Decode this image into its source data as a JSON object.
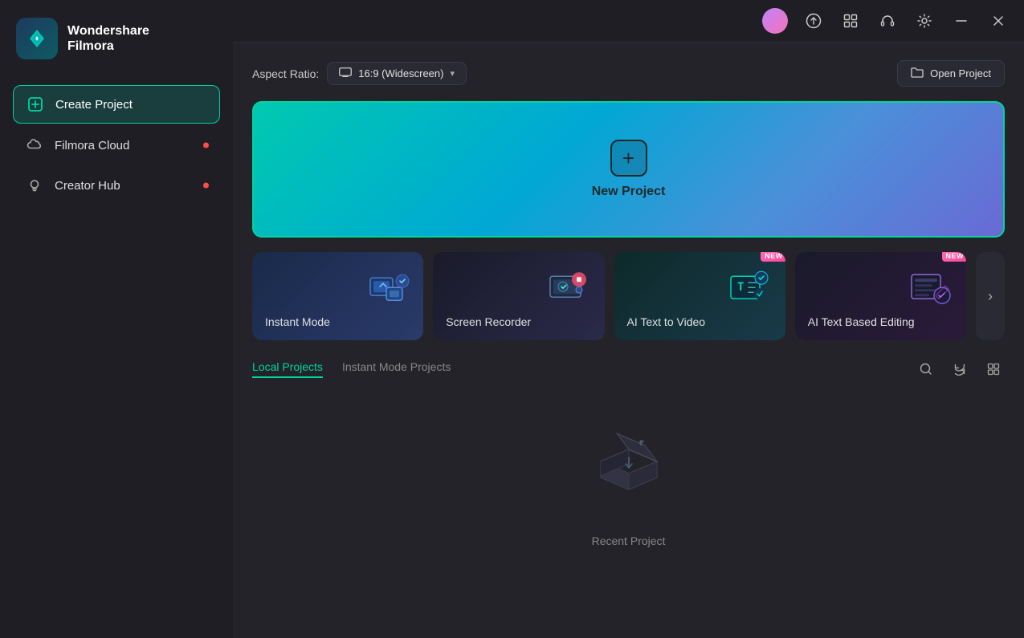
{
  "app": {
    "name": "Wondershare",
    "product": "Filmora"
  },
  "topbar": {
    "icons": [
      "grid-icon",
      "headset-icon",
      "badge-icon",
      "minimize-icon",
      "close-icon"
    ]
  },
  "sidebar": {
    "items": [
      {
        "id": "create-project",
        "label": "Create Project",
        "icon": "plus-square-icon",
        "active": true,
        "badge": false
      },
      {
        "id": "filmora-cloud",
        "label": "Filmora Cloud",
        "icon": "cloud-icon",
        "active": false,
        "badge": true
      },
      {
        "id": "creator-hub",
        "label": "Creator Hub",
        "icon": "lightbulb-icon",
        "active": false,
        "badge": true
      }
    ]
  },
  "aspect_ratio": {
    "label": "Aspect Ratio:",
    "value": "16:9 (Widescreen)",
    "icon": "monitor-icon"
  },
  "open_project": {
    "label": "Open Project",
    "icon": "folder-icon"
  },
  "new_project": {
    "label": "New Project"
  },
  "feature_cards": [
    {
      "id": "instant-mode",
      "label": "Instant Mode",
      "badge": null
    },
    {
      "id": "screen-recorder",
      "label": "Screen Recorder",
      "badge": null
    },
    {
      "id": "ai-text-to-video",
      "label": "AI Text to Video",
      "badge": "NEW"
    },
    {
      "id": "ai-text-based-editing",
      "label": "AI Text Based Editing",
      "badge": "NEW"
    }
  ],
  "project_tabs": [
    {
      "id": "local-projects",
      "label": "Local Projects",
      "active": true
    },
    {
      "id": "instant-mode-projects",
      "label": "Instant Mode Projects",
      "active": false
    }
  ],
  "tab_icons": [
    "search-icon",
    "refresh-icon",
    "grid-view-icon"
  ],
  "empty_state": {
    "label": "Recent Project"
  },
  "arrow": {
    "label": "›"
  }
}
